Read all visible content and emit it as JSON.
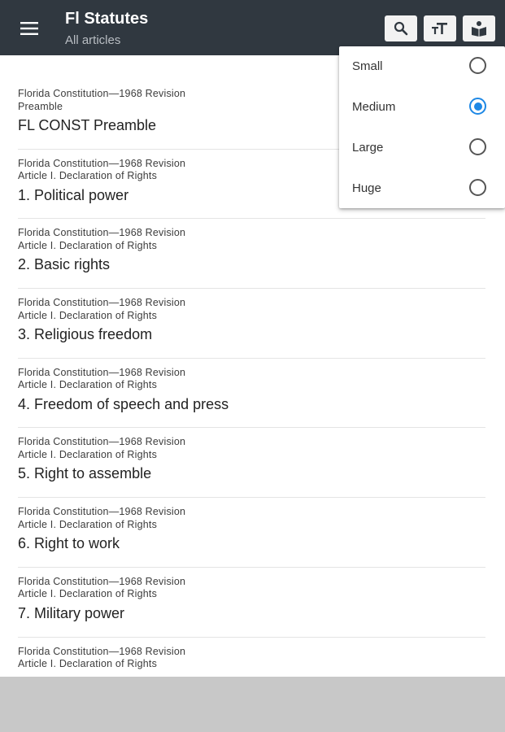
{
  "appbar": {
    "title": "Fl Statutes",
    "subtitle": "All articles",
    "icons": [
      "menu-icon",
      "search-icon",
      "text-size-icon",
      "book-reader-icon"
    ],
    "background": "#303840"
  },
  "articles": [
    {
      "line1": "Florida Constitution—1968 Revision",
      "line2": "Preamble",
      "title": "FL CONST Preamble"
    },
    {
      "line1": "Florida Constitution—1968 Revision",
      "line2": "Article I. Declaration of Rights",
      "title": "1. Political power"
    },
    {
      "line1": "Florida Constitution—1968 Revision",
      "line2": "Article I. Declaration of Rights",
      "title": "2. Basic rights"
    },
    {
      "line1": "Florida Constitution—1968 Revision",
      "line2": "Article I. Declaration of Rights",
      "title": "3. Religious freedom"
    },
    {
      "line1": "Florida Constitution—1968 Revision",
      "line2": "Article I. Declaration of Rights",
      "title": "4. Freedom of speech and press"
    },
    {
      "line1": "Florida Constitution—1968 Revision",
      "line2": "Article I. Declaration of Rights",
      "title": "5. Right to assemble"
    },
    {
      "line1": "Florida Constitution—1968 Revision",
      "line2": "Article I. Declaration of Rights",
      "title": "6. Right to work"
    },
    {
      "line1": "Florida Constitution—1968 Revision",
      "line2": "Article I. Declaration of Rights",
      "title": "7. Military power"
    },
    {
      "line1": "Florida Constitution—1968 Revision",
      "line2": "Article I. Declaration of Rights",
      "title": ""
    }
  ],
  "font_size_menu": {
    "options": [
      {
        "label": "Small",
        "selected": false
      },
      {
        "label": "Medium",
        "selected": true
      },
      {
        "label": "Large",
        "selected": false
      },
      {
        "label": "Huge",
        "selected": false
      }
    ],
    "accent": "#1e88e5"
  }
}
